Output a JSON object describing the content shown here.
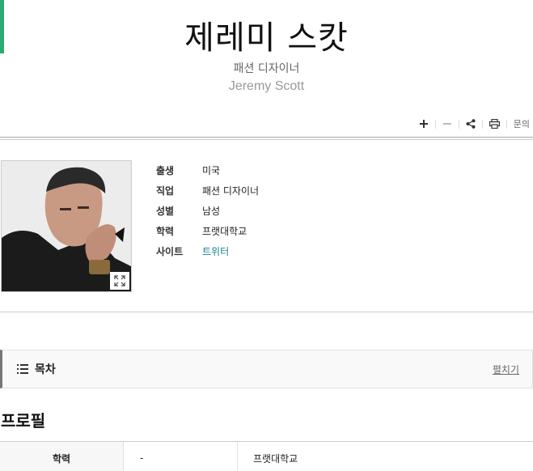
{
  "header": {
    "title": "제레미 스캇",
    "subtitle": "패션 디자이너",
    "english_name": "Jeremy Scott",
    "accent_color": "#2bab6f"
  },
  "toolbar": {
    "zoom_in_icon": "plus-icon",
    "zoom_out_icon": "minus-icon",
    "share_icon": "share-icon",
    "print_icon": "printer-icon",
    "inquiry_label": "문의"
  },
  "info": {
    "rows": [
      {
        "key": "출생",
        "value": "미국"
      },
      {
        "key": "직업",
        "value": "패션 디자이너"
      },
      {
        "key": "성별",
        "value": "남성"
      },
      {
        "key": "학력",
        "value": "프랫대학교"
      },
      {
        "key": "사이트",
        "value": "트위터"
      }
    ],
    "link_color": "#1a7f8f"
  },
  "toc": {
    "title": "목차",
    "toggle_label": "펼치기"
  },
  "profile": {
    "section_title": "프로필",
    "rows": [
      {
        "key": "학력",
        "period": "-",
        "value": "프랫대학교"
      }
    ]
  }
}
